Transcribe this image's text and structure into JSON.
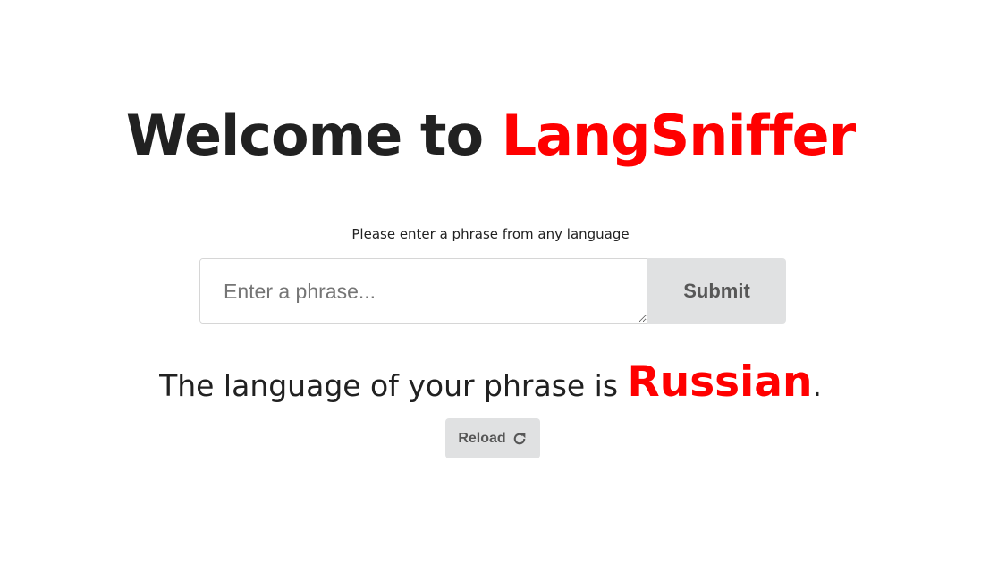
{
  "header": {
    "title_prefix": "Welcome to ",
    "title_brand": "LangSniffer"
  },
  "form": {
    "prompt": "Please enter a phrase from any language",
    "input_value": "",
    "input_placeholder": "Enter a phrase...",
    "submit_label": "Submit"
  },
  "result": {
    "prefix": "The language of your phrase is ",
    "language": "Russian",
    "suffix": "."
  },
  "reload": {
    "label": "Reload",
    "icon": "reload-icon"
  },
  "colors": {
    "accent": "#ff0000",
    "text": "#212121",
    "button_bg": "#e0e1e2",
    "button_text": "#575757"
  }
}
